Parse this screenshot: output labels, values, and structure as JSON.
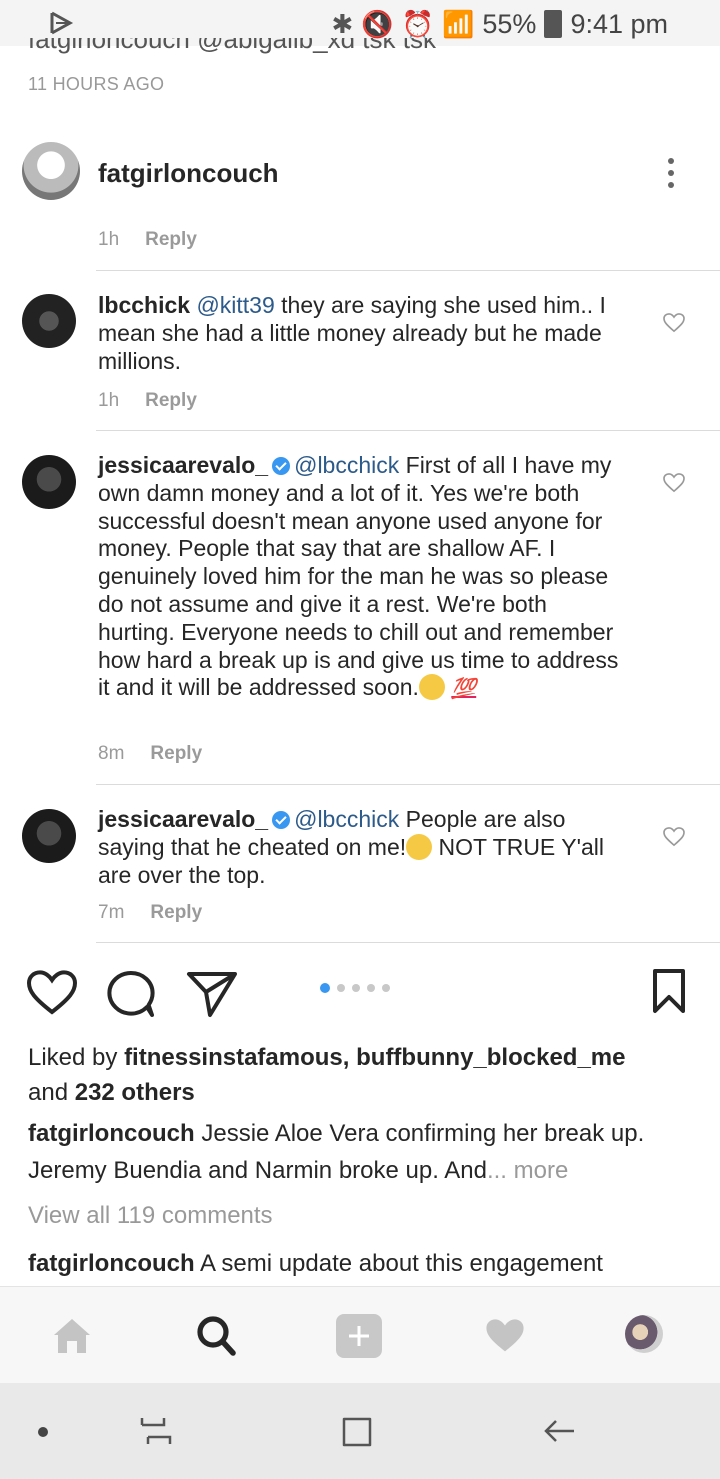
{
  "status_bar": {
    "battery": "55%",
    "time": "9:41 pm"
  },
  "top_partial": {
    "cut_text": "fatgirloncouch @abigailb_xd tsk tsk",
    "timestamp": "11 HOURS AGO"
  },
  "comments": [
    {
      "username": "fatgirloncouch",
      "text": "",
      "time": "1h",
      "reply_label": "Reply"
    },
    {
      "username": "lbcchick",
      "mention": "@kitt39",
      "text": " they are saying she used him.. I mean she had a little money already but he made millions.",
      "time": "1h",
      "reply_label": "Reply"
    },
    {
      "username": "jessicaarevalo_",
      "mention": "@lbcchick",
      "text": " First of all I have my own damn money and a lot of it. Yes we're both successful doesn't mean anyone used anyone for money. People that say that are shallow AF. I genuinely loved him for the man he was so please do not assume and give it a rest. We're both hurting. Everyone needs to chill out and remember how hard a break up is and give us time to address it and it will be addressed soon.",
      "emoji_text": "💯",
      "time": "8m",
      "reply_label": "Reply"
    },
    {
      "username": "jessicaarevalo_",
      "mention": "@lbcchick",
      "text": " People are also saying that he cheated on me!",
      "text2": " NOT TRUE Y'all are over the top.",
      "time": "7m",
      "reply_label": "Reply"
    }
  ],
  "post": {
    "liked_by_prefix": "Liked by ",
    "liked_by_users": "fitnessinstafamous, buffbunny_blocked_me",
    "liked_and": "and ",
    "liked_others": "232 others",
    "caption_user": "fatgirloncouch",
    "caption_text": " Jessie Aloe Vera confirming her break up. Jeremy Buendia and Narmin broke up. And",
    "caption_more": "... more",
    "view_all": "View all 119 comments",
    "comment_user": "fatgirloncouch",
    "comment_text": " A semi update about this engagement"
  },
  "icons": {
    "like": "heart-icon",
    "comment": "comment-icon",
    "share": "send-icon",
    "save": "bookmark-icon",
    "nav": [
      "home-icon",
      "search-icon",
      "add-icon",
      "activity-heart-icon",
      "profile-avatar"
    ],
    "system": [
      "recent-apps-dot",
      "recents-icon",
      "home-square-icon",
      "back-icon"
    ]
  },
  "colors": {
    "mention": "#2c5a8a",
    "verified": "#3897f0",
    "carousel_active": "#3897f0"
  }
}
